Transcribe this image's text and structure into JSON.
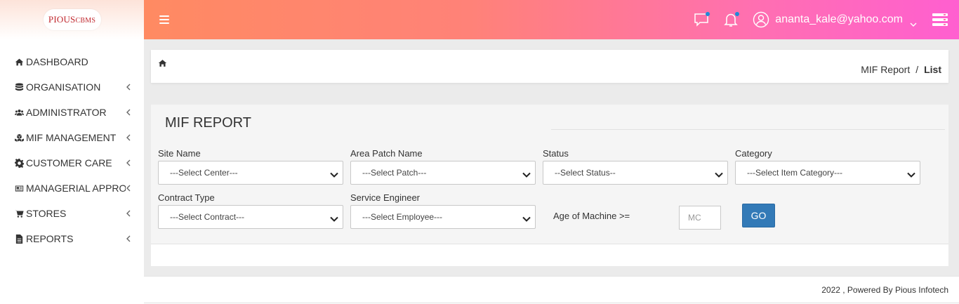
{
  "brand": {
    "logo_main": "PIOUS",
    "logo_suffix": "CBMS"
  },
  "sidebar": {
    "items": [
      {
        "label": "DASHBOARD",
        "icon": "home-icon",
        "has_submenu": false
      },
      {
        "label": "ORGANISATION",
        "icon": "database-icon",
        "has_submenu": true
      },
      {
        "label": "ADMINISTRATOR",
        "icon": "users-icon",
        "has_submenu": true
      },
      {
        "label": "MIF MANAGEMENT",
        "icon": "cubes-icon",
        "has_submenu": true
      },
      {
        "label": "CUSTOMER CARE",
        "icon": "gear-icon",
        "has_submenu": true
      },
      {
        "label": "MANAGERIAL APPRO..",
        "icon": "newspaper-icon",
        "has_submenu": true
      },
      {
        "label": "STORES",
        "icon": "cart-icon",
        "has_submenu": true
      },
      {
        "label": "REPORTS",
        "icon": "file-icon",
        "has_submenu": true
      }
    ]
  },
  "header": {
    "user_email": "ananta_kale@yahoo.com",
    "colors": {
      "gradient_start": "#ff8a62",
      "gradient_end": "#ff5fd0",
      "notification_dot": "#1f8bd8"
    }
  },
  "breadcrumb": {
    "parent": "MIF Report",
    "separator": "/",
    "current": "List"
  },
  "report": {
    "title": "MIF REPORT",
    "fields": {
      "site_name": {
        "label": "Site Name",
        "value": "---Select Center---"
      },
      "area_patch": {
        "label": "Area Patch Name",
        "value": "---Select Patch---"
      },
      "status": {
        "label": "Status",
        "value": "--Select Status--"
      },
      "category": {
        "label": "Category",
        "value": "---Select Item Category---"
      },
      "contract_type": {
        "label": "Contract Type",
        "value": "---Select Contract---"
      },
      "service_engineer": {
        "label": "Service Engineer",
        "value": "---Select Employee---"
      }
    },
    "age_label": "Age of Machine >=",
    "age_placeholder": "MC",
    "go_label": "GO",
    "go_color": "#337ab7"
  },
  "footer": {
    "text": "2022 , Powered By Pious Infotech"
  }
}
